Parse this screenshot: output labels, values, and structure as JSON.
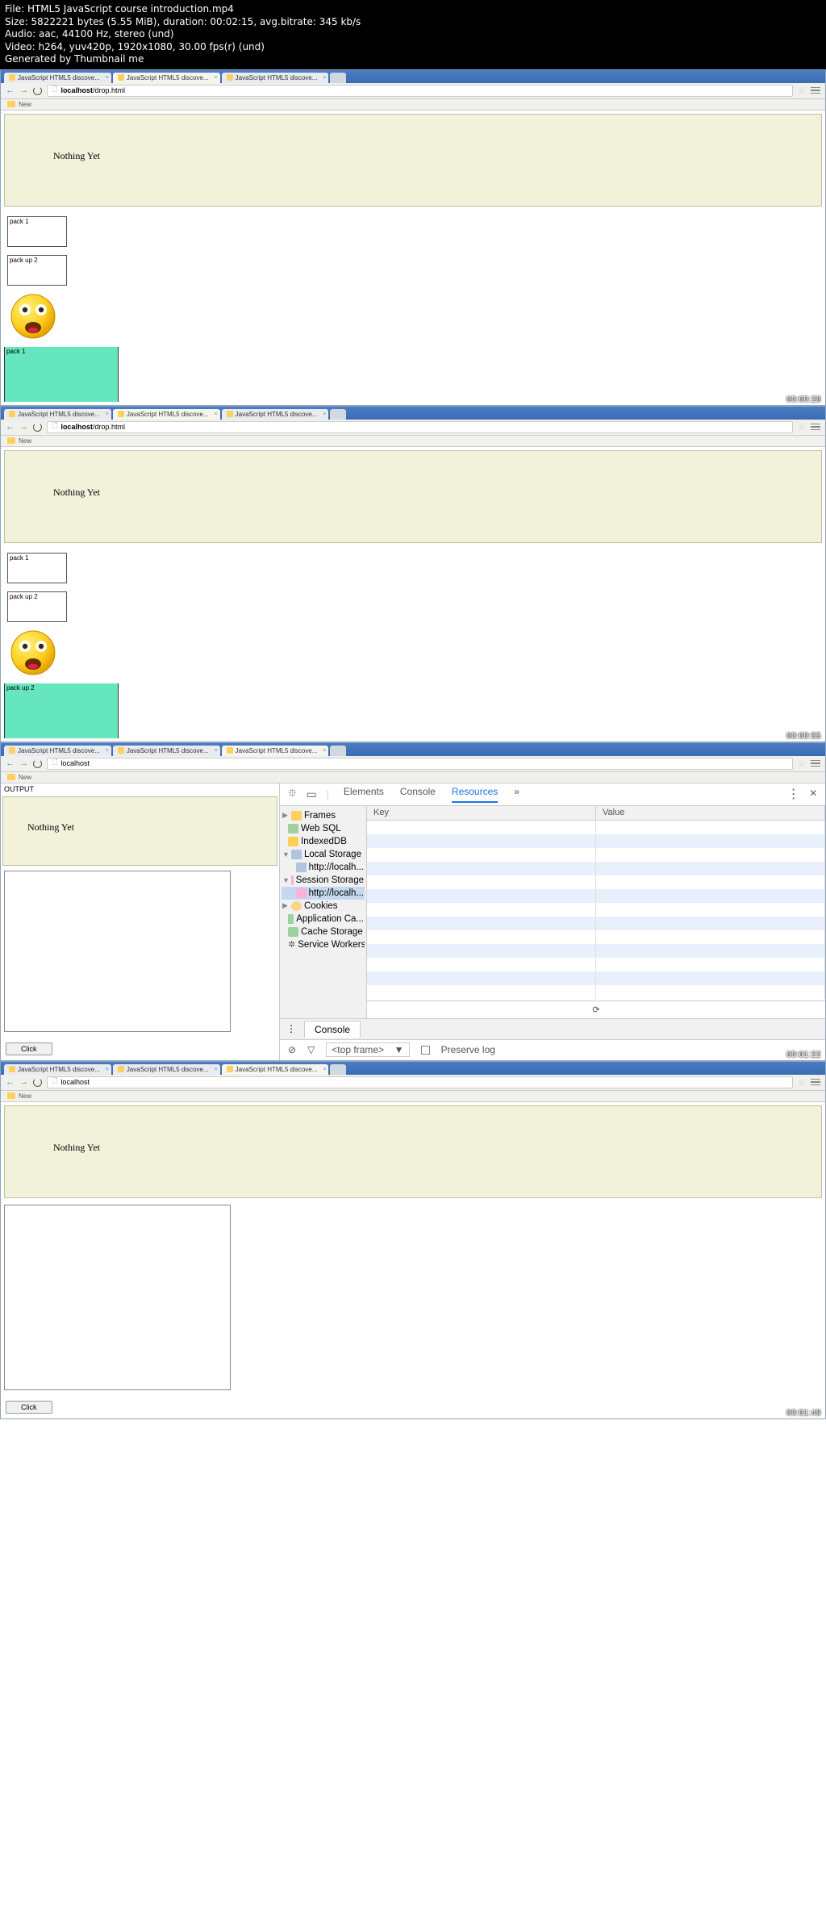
{
  "info": {
    "file_line": "File: HTML5 JavaScript course introduction.mp4",
    "size_line": "Size: 5822221 bytes (5.55 MiB), duration: 00:02:15, avg.bitrate: 345 kb/s",
    "audio_line": "Audio: aac, 44100 Hz, stereo (und)",
    "video_line": "Video: h264, yuv420p, 1920x1080, 30.00 fps(r) (und)",
    "gen_line": "Generated by Thumbnail me"
  },
  "tabs": {
    "t1": "JavaScript HTML5 discove...",
    "t2": "JavaScript HTML5 discove...",
    "t3": "JavaScript HTML5 discove..."
  },
  "urls": {
    "drop": "localhost/drop.html",
    "local": "localhost"
  },
  "bookmark": {
    "label": "New"
  },
  "page": {
    "nothing_yet": "Nothing Yet",
    "pack1": "pack 1",
    "pack2": "pack up 2",
    "dropzone_pack1": "pack 1",
    "dropzone_pack2": "pack up 2",
    "output_label": "OUTPUT",
    "click": "Click"
  },
  "timestamps": {
    "f1": "00:00:28",
    "f2": "00:00:55",
    "f3": "00:01:22",
    "f4": "00:01:49"
  },
  "devtools": {
    "tabs": {
      "elements": "Elements",
      "console": "Console",
      "resources": "Resources"
    },
    "tree": {
      "frames": "Frames",
      "websql": "Web SQL",
      "indexeddb": "IndexedDB",
      "localstorage": "Local Storage",
      "local_url": "http://localh...",
      "sessionstorage": "Session Storage",
      "session_url": "http://localh...",
      "cookies": "Cookies",
      "appcache": "Application Ca...",
      "cachestorage": "Cache Storage",
      "serviceworkers": "Service Workers"
    },
    "kv": {
      "key": "Key",
      "value": "Value"
    },
    "console_label": "Console",
    "filter": {
      "topframe": "<top frame>",
      "preserve": "Preserve log"
    }
  }
}
